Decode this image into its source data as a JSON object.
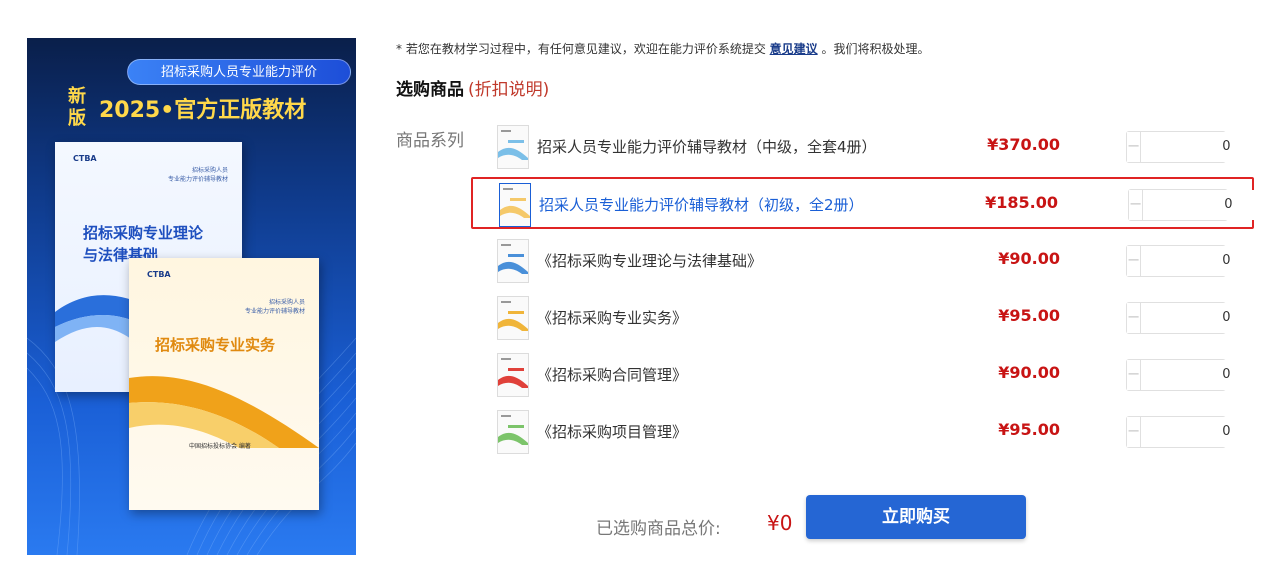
{
  "banner": {
    "pill_text": "招标采购人员专业能力评价",
    "new_badge": "新版",
    "title": "2025•官方正版教材",
    "book1": {
      "logo": "CTBA",
      "subtitle": "招标采购人员\n专业能力评价辅导教材",
      "name": "招标采购专业理论\n与法律基础"
    },
    "book2": {
      "logo": "CTBA",
      "subtitle": "招标采购人员\n专业能力评价辅导教材",
      "name": "招标采购专业实务",
      "publisher": "中国招标投标协会  编著"
    }
  },
  "notice": {
    "prefix": "* 若您在教材学习过程中，有任何意见建议，欢迎在能力评价系统提交 ",
    "link": "意见建议",
    "suffix": " 。我们将积极处理。"
  },
  "section": {
    "title": "选购商品",
    "discount": "(折扣说明)"
  },
  "series_label": "商品系列",
  "products": [
    {
      "name": "招采人员专业能力评价辅导教材（中级，全套4册）",
      "price": "¥370.00",
      "qty": "0",
      "thumb_color": "#7bbfe8",
      "selected": false
    },
    {
      "name": "招采人员专业能力评价辅导教材（初级，全2册）",
      "price": "¥185.00",
      "qty": "0",
      "thumb_color": "#f5c96a",
      "selected": true
    },
    {
      "name": "《招标采购专业理论与法律基础》",
      "price": "¥90.00",
      "qty": "0",
      "thumb_color": "#4a90d9",
      "selected": false
    },
    {
      "name": "《招标采购专业实务》",
      "price": "¥95.00",
      "qty": "0",
      "thumb_color": "#f0b53a",
      "selected": false
    },
    {
      "name": "《招标采购合同管理》",
      "price": "¥90.00",
      "qty": "0",
      "thumb_color": "#e0413a",
      "selected": false
    },
    {
      "name": "《招标采购项目管理》",
      "price": "¥95.00",
      "qty": "0",
      "thumb_color": "#7cc46a",
      "selected": false
    }
  ],
  "stepper": {
    "minus": "−",
    "plus": "+"
  },
  "total": {
    "label": "已选购商品总价:",
    "value": "¥0"
  },
  "buy_button": "立即购买"
}
